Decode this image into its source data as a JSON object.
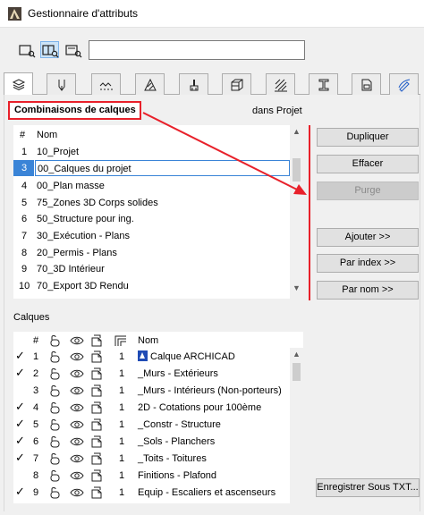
{
  "window": {
    "title": "Gestionnaire d'attributs"
  },
  "search": {
    "value": ""
  },
  "toolbar": {
    "icons": [
      "attribute-list-view-icon",
      "split-view-icon",
      "detail-view-icon"
    ]
  },
  "tabs": [
    "layers-tab",
    "pen-tab",
    "line-type-tab",
    "fill-tab",
    "surface-tab",
    "building-material-tab",
    "composite-tab",
    "profile-tab",
    "zone-tab",
    "markup-style-tab"
  ],
  "combinations": {
    "title": "Combinaisons de calques",
    "scope": "dans Projet",
    "header": {
      "num": "#",
      "name": "Nom"
    },
    "rows": [
      {
        "num": "1",
        "name": "10_Projet"
      },
      {
        "num": "3",
        "name": "00_Calques du projet"
      },
      {
        "num": "4",
        "name": "00_Plan masse"
      },
      {
        "num": "5",
        "name": "75_Zones 3D Corps solides"
      },
      {
        "num": "6",
        "name": "50_Structure pour ing."
      },
      {
        "num": "7",
        "name": "30_Exécution - Plans"
      },
      {
        "num": "8",
        "name": "20_Permis - Plans"
      },
      {
        "num": "9",
        "name": "70_3D Intérieur"
      },
      {
        "num": "10",
        "name": "70_Export 3D Rendu"
      }
    ]
  },
  "buttons": {
    "dupliquer": "Dupliquer",
    "effacer": "Effacer",
    "purge": "Purge",
    "ajouter": "Ajouter >>",
    "par_index": "Par index >>",
    "par_nom": "Par nom >>",
    "enregistrer": "Enregistrer Sous TXT..."
  },
  "layers": {
    "title": "Calques",
    "header": {
      "num": "#",
      "intersection": "1",
      "name": "Nom"
    },
    "rows": [
      {
        "checked": true,
        "num": "1",
        "group": "1",
        "name": "Calque ARCHICAD",
        "special": true
      },
      {
        "checked": true,
        "num": "2",
        "group": "1",
        "name": "_Murs - Extérieurs"
      },
      {
        "checked": false,
        "num": "3",
        "group": "1",
        "name": "_Murs - Intérieurs (Non-porteurs)"
      },
      {
        "checked": true,
        "num": "4",
        "group": "1",
        "name": "2D - Cotations pour 100ème"
      },
      {
        "checked": true,
        "num": "5",
        "group": "1",
        "name": "_Constr - Structure"
      },
      {
        "checked": true,
        "num": "6",
        "group": "1",
        "name": "_Sols - Planchers"
      },
      {
        "checked": true,
        "num": "7",
        "group": "1",
        "name": "_Toits - Toitures"
      },
      {
        "checked": false,
        "num": "8",
        "group": "1",
        "name": "Finitions - Plafond"
      },
      {
        "checked": true,
        "num": "9",
        "group": "1",
        "name": "Equip - Escaliers et ascenseurs"
      }
    ]
  },
  "colors": {
    "accent_red": "#e8202a",
    "selection_blue": "#3a84d7",
    "layer_badge": "#1f4bb5"
  }
}
